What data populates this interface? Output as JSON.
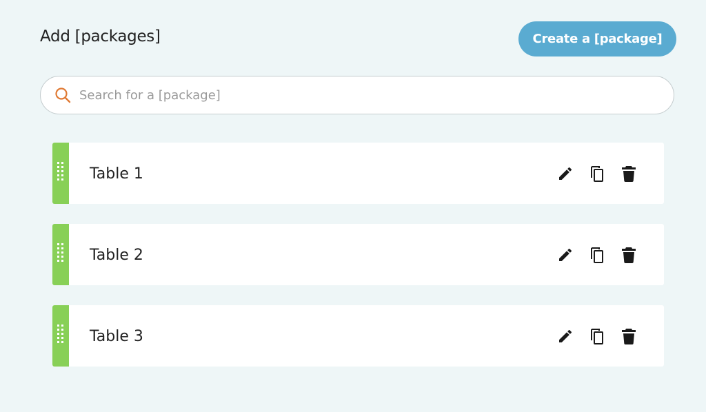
{
  "header": {
    "title": "Add [packages]",
    "create_button_label": "Create a [package]"
  },
  "search": {
    "placeholder": "Search for a [package]",
    "value": ""
  },
  "items": [
    {
      "label": "Table 1"
    },
    {
      "label": "Table 2"
    },
    {
      "label": "Table 3"
    }
  ],
  "colors": {
    "background": "#eef6f7",
    "accent_button": "#5aabd1",
    "drag_handle": "#88d057",
    "search_icon": "#e07a34"
  },
  "icons": {
    "search": "search-icon",
    "drag": "drag-handle-icon",
    "edit": "pencil-icon",
    "duplicate": "copy-icon",
    "delete": "trash-icon"
  }
}
